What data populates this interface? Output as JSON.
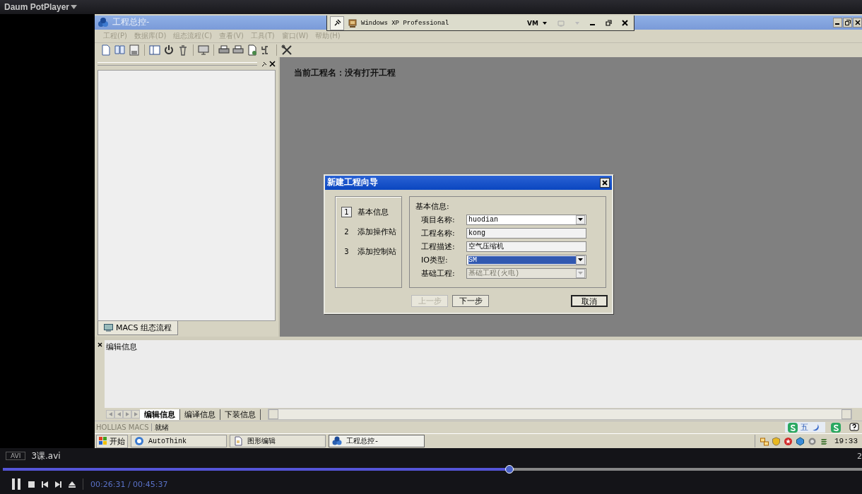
{
  "player": {
    "title": "Daum PotPlayer",
    "format": "AVI",
    "file": "3课.avi",
    "corner_text": "2",
    "level": 0.59,
    "time": "00:26:31 / 00:45:37"
  },
  "vm_bar": {
    "title": "Windows XP Professional",
    "menu": "VM"
  },
  "window": {
    "title": "工程总控-"
  },
  "menu": [
    {
      "label": "工程(P)",
      "disabled": true
    },
    {
      "label": "数据库(D)",
      "disabled": true
    },
    {
      "label": "组态流程(C)",
      "disabled": true
    },
    {
      "label": "查看(V)",
      "disabled": true
    },
    {
      "label": "工具(T)",
      "disabled": true
    },
    {
      "label": "窗口(W)",
      "disabled": true
    },
    {
      "label": "帮助(H)",
      "disabled": true
    }
  ],
  "left_panel": {
    "tab": "MACS 组态流程"
  },
  "workspace": {
    "message": "当前工程名：没有打开工程"
  },
  "dialog": {
    "title": "新建工程向导",
    "steps": [
      {
        "number": "1",
        "label": "基本信息",
        "selected": true
      },
      {
        "number": "2",
        "label": "添加操作站",
        "selected": false
      },
      {
        "number": "3",
        "label": "添加控制站",
        "selected": false
      }
    ],
    "group": "基本信息:",
    "fields": [
      {
        "label": "项目名称:",
        "value": "huodian",
        "kind": "combo",
        "disabled": false,
        "focused": false
      },
      {
        "label": "工程名称:",
        "value": "kong",
        "kind": "text",
        "disabled": false,
        "focused": false
      },
      {
        "label": "工程描述:",
        "value": "空气压缩机",
        "kind": "text",
        "disabled": false,
        "focused": false
      },
      {
        "label": "IO类型:",
        "value": "SM",
        "kind": "combo",
        "disabled": false,
        "focused": true
      },
      {
        "label": "基础工程:",
        "value": "基础工程(火电)",
        "kind": "combo",
        "disabled": true,
        "focused": false
      }
    ],
    "buttons": [
      {
        "label": "上一步",
        "disabled": true,
        "default": false
      },
      {
        "label": "下一步",
        "disabled": false,
        "default": false
      },
      {
        "label": "取消",
        "disabled": false,
        "default": true
      }
    ]
  },
  "output": {
    "text": "编辑信息",
    "tabs": [
      {
        "label": "编辑信息",
        "selected": true
      },
      {
        "label": "编译信息",
        "selected": false
      },
      {
        "label": "下装信息",
        "selected": false
      }
    ]
  },
  "status_bar": {
    "brand": "HOLLIAS MACS",
    "text": "就绪",
    "ime_label": "五"
  },
  "taskbar": {
    "start": "开始",
    "items": [
      {
        "label": "AutoThink",
        "selected": false
      },
      {
        "label": "图形编辑",
        "selected": false
      },
      {
        "label": "工程总控-",
        "selected": true
      }
    ],
    "clock": "19:33"
  }
}
